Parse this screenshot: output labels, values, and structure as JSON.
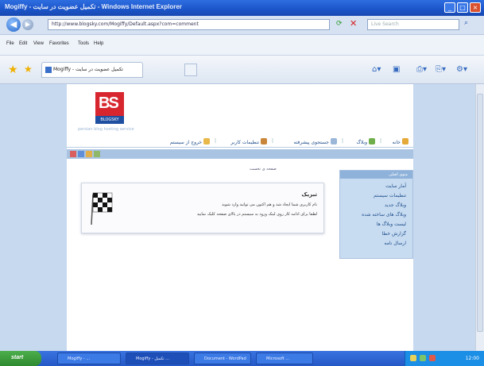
{
  "window": {
    "title": "Mogiffy - تکميل عضويت در سايت - Windows Internet Explorer",
    "controls": [
      "_",
      "□",
      "×"
    ]
  },
  "address": {
    "url": "http://www.blogsky.com/Mogiffy/Default.aspx?com=comment",
    "search_placeholder": "Live Search"
  },
  "menu": [
    "File",
    "Edit",
    "View",
    "Favorites",
    "Tools",
    "Help"
  ],
  "tab": {
    "label": "Mogiffy - تکميل عضويت در سايت"
  },
  "site": {
    "logo_text": "BS",
    "logo_sub": "BLOGSKY",
    "tagline": "persian blog hosting service",
    "topnav": [
      "خانه",
      "وبلاگ",
      "جستجوی پیشرفته",
      "تنظيمات کاربر",
      "خروج از سیستم"
    ],
    "breadcrumb": "صفحه ی نخست",
    "sidebar_title": "منوی اصلی",
    "sidebar_items": [
      "آمار سایت",
      "تنظیمات سیستم",
      "وبلاگ جدید",
      "وبلاگ های ساخته شده",
      "لیست وبلاگ ها",
      "گزارش خطا",
      "ارسال نامه"
    ],
    "message_title": "تبریک",
    "message_line1": "نام کاربری شما ایجاد شد و هم اکنون می توانید وارد شوید",
    "message_line2": "لطفا برای ادامه کار روی لینک ورود به سیستم در بالای صفحه کلیک نمایید"
  },
  "taskbar": {
    "start_label": "start",
    "tasks": [
      "Mogiffy - ...",
      "Mogiffy - تکميل ...",
      "Document - WordPad",
      "Microsoft ..."
    ],
    "clock": "12:00"
  }
}
